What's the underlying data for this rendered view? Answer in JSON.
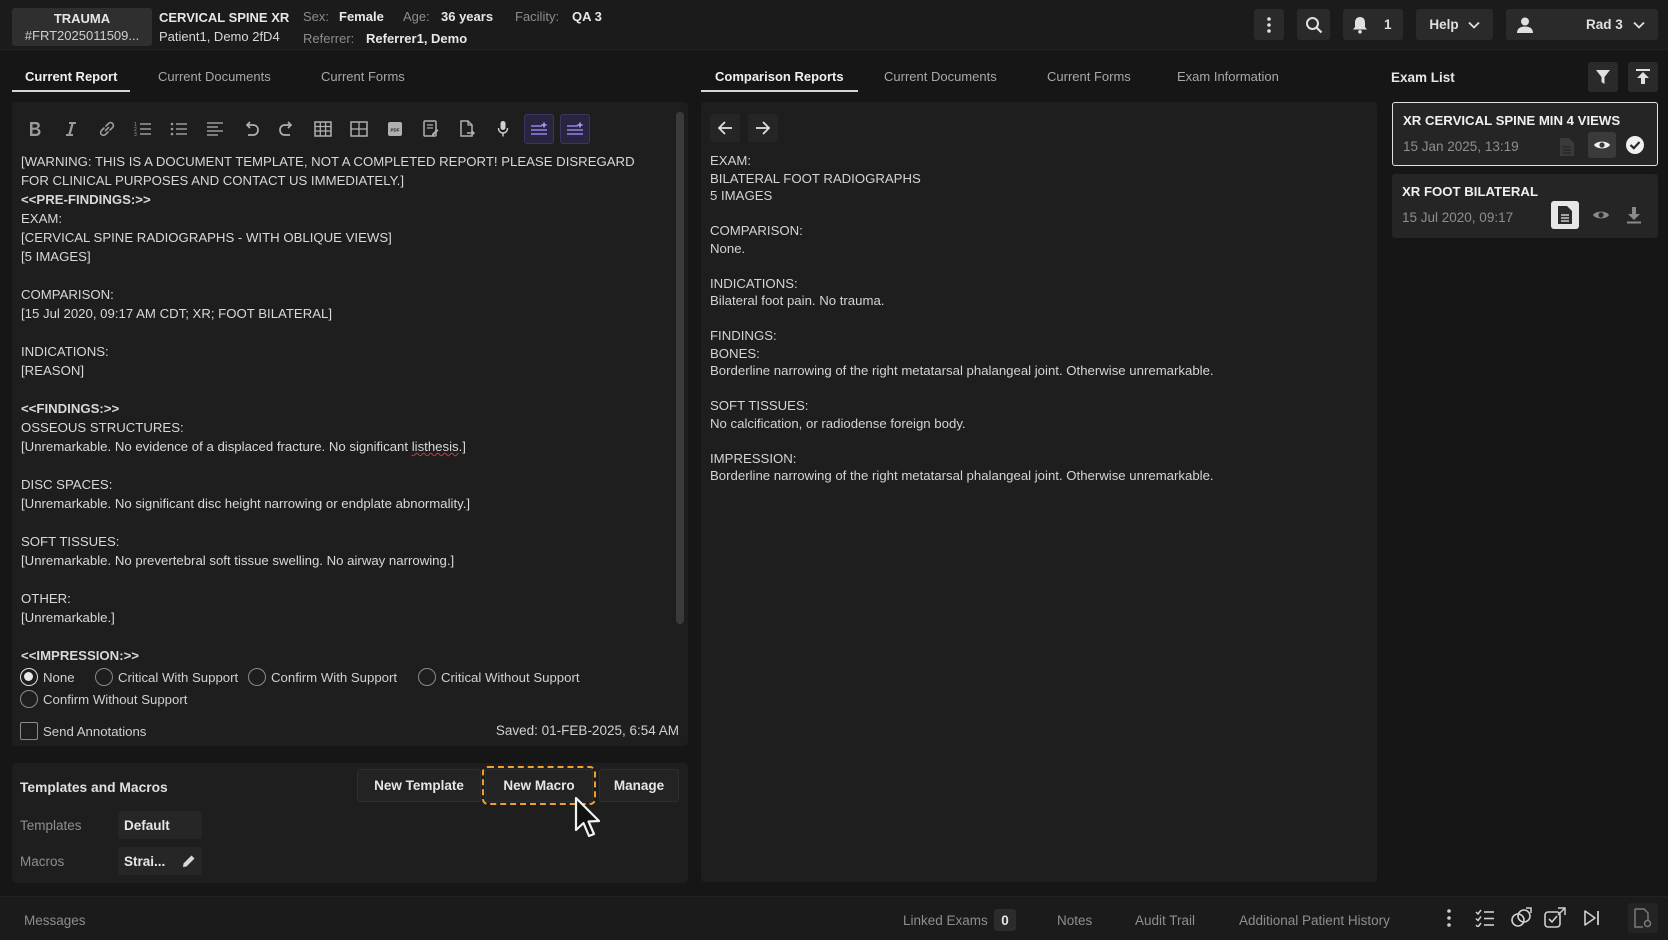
{
  "header": {
    "badge_title": "TRAUMA",
    "badge_id": "#FRT2025011509...",
    "exam_title": "CERVICAL SPINE XR",
    "patient_name": "Patient1, Demo 2fD4",
    "sex_label": "Sex:",
    "sex_value": "Female",
    "age_label": "Age:",
    "age_value": "36 years",
    "facility_label": "Facility:",
    "facility_value": "QA 3",
    "referrer_label": "Referrer:",
    "referrer_value": "Referrer1, Demo",
    "notifications_count": "1",
    "help_label": "Help",
    "user_label": "Rad 3"
  },
  "left_tabs": [
    "Current Report",
    "Current Documents",
    "Current Forms"
  ],
  "right_tabs": [
    "Comparison Reports",
    "Current Documents",
    "Current Forms",
    "Exam Information"
  ],
  "editor": {
    "lines": [
      {
        "t": "[WARNING: THIS IS A DOCUMENT TEMPLATE, NOT A COMPLETED REPORT! PLEASE DISREGARD"
      },
      {
        "t": "FOR CLINICAL PURPOSES AND CONTACT US IMMEDIATELY.]"
      },
      {
        "t": "<<PRE-FINDINGS:>>",
        "b": true
      },
      {
        "t": "EXAM:"
      },
      {
        "t": "[CERVICAL SPINE RADIOGRAPHS - WITH OBLIQUE VIEWS]"
      },
      {
        "t": "[5 IMAGES]"
      },
      {
        "t": ""
      },
      {
        "t": "COMPARISON:"
      },
      {
        "t": "[15 Jul 2020, 09:17 AM CDT; XR; FOOT BILATERAL]"
      },
      {
        "t": ""
      },
      {
        "t": "INDICATIONS:"
      },
      {
        "t": "[REASON]"
      },
      {
        "t": ""
      },
      {
        "t": "<<FINDINGS:>>",
        "b": true
      },
      {
        "t": "OSSEOUS STRUCTURES:"
      },
      {
        "t": "[Unremarkable. No evidence of a displaced fracture. No significant ",
        "sq": "listhesis",
        "after": ".]"
      },
      {
        "t": ""
      },
      {
        "t": "DISC SPACES:"
      },
      {
        "t": "[Unremarkable. No significant disc height narrowing or endplate abnormality.]"
      },
      {
        "t": ""
      },
      {
        "t": "SOFT TISSUES:"
      },
      {
        "t": "[Unremarkable. No prevertebral soft tissue swelling. No airway narrowing.]"
      },
      {
        "t": ""
      },
      {
        "t": "OTHER:"
      },
      {
        "t": "[Unremarkable.]"
      },
      {
        "t": ""
      },
      {
        "t": "<<IMPRESSION:>>",
        "b": true
      }
    ],
    "radios": [
      "None",
      "Critical With Support",
      "Confirm With Support",
      "Critical Without Support",
      "Confirm Without Support"
    ],
    "selected_radio": "None",
    "send_annotations_label": "Send Annotations",
    "saved_text": "Saved: 01-FEB-2025, 6:54 AM"
  },
  "templates": {
    "title": "Templates and Macros",
    "new_template": "New Template",
    "new_macro": "New Macro",
    "manage": "Manage",
    "templates_label": "Templates",
    "templates_value": "Default",
    "macros_label": "Macros",
    "macros_value": "Strai..."
  },
  "comparison": {
    "lines": [
      "EXAM:",
      "BILATERAL FOOT RADIOGRAPHS",
      "5 IMAGES",
      "",
      "COMPARISON:",
      "None.",
      "",
      "INDICATIONS:",
      "Bilateral foot pain. No trauma.",
      "",
      "FINDINGS:",
      "BONES:",
      "Borderline narrowing of the right metatarsal phalangeal joint. Otherwise unremarkable.",
      "",
      "SOFT TISSUES:",
      "No calcification, or radiodense foreign body.",
      "",
      "IMPRESSION:",
      "Borderline narrowing of the right metatarsal phalangeal joint. Otherwise unremarkable."
    ]
  },
  "exam_list": {
    "title": "Exam List",
    "items": [
      {
        "title": "XR CERVICAL SPINE MIN 4 VIEWS",
        "date": "15 Jan 2025, 13:19"
      },
      {
        "title": "XR FOOT BILATERAL",
        "date": "15 Jul 2020, 09:17"
      }
    ]
  },
  "bottom": {
    "messages": "Messages",
    "linked_exams": "Linked Exams",
    "linked_count": "0",
    "notes": "Notes",
    "audit_trail": "Audit Trail",
    "additional_history": "Additional Patient History"
  },
  "colors": {
    "background": "#161616",
    "panel": "#1e1e1e",
    "accent_purple": "#8b7ee0",
    "highlight_orange": "#f0a030"
  }
}
